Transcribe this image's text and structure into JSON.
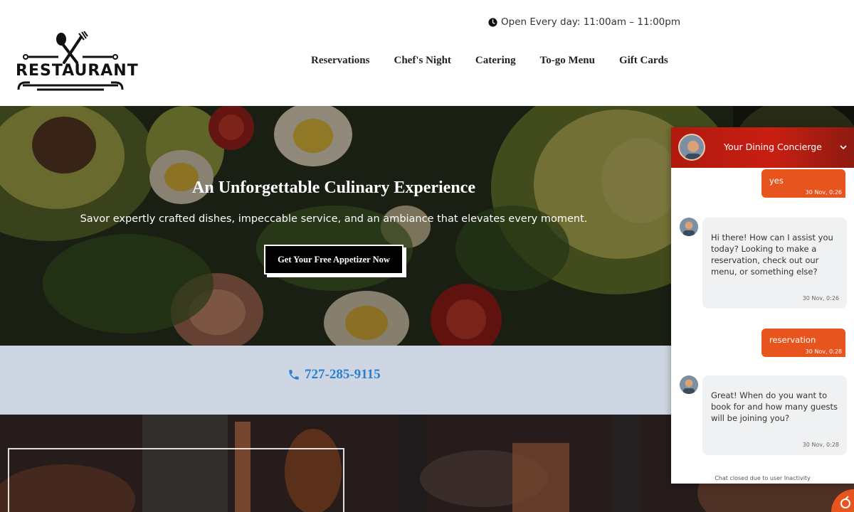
{
  "header": {
    "logo_text": "RESTAURANT",
    "hours": "Open Every day: 11:00am – 11:00pm",
    "nav": [
      "Reservations",
      "Chef's Night",
      "Catering",
      "To-go Menu",
      "Gift Cards"
    ]
  },
  "hero": {
    "title": "An Unforgettable Culinary Experience",
    "subtitle": "Savor expertly crafted dishes, impeccable service, and an ambiance that elevates every moment.",
    "cta": "Get Your Free Appetizer Now"
  },
  "contact": {
    "phone": "727-285-9115"
  },
  "chat": {
    "title": "Your Dining Concierge",
    "messages": [
      {
        "from": "user",
        "text": "yes",
        "time": "30 Nov, 0:26"
      },
      {
        "from": "bot",
        "text": "Hi there! How can I assist you today? Looking to make a reservation, check out our menu, or something else?",
        "time": "30 Nov, 0:26"
      },
      {
        "from": "user",
        "text": "reservation",
        "time": "30 Nov, 0:28"
      },
      {
        "from": "bot",
        "text": "Great! When do you want to book for and how many guests will be joining you?",
        "time": "30 Nov, 0:28"
      }
    ],
    "closed_notice": "Chat closed due to user Inactivity"
  },
  "colors": {
    "accent": "#e8541e",
    "chat_header": "#c81f12",
    "phone_link": "#2a7fd4",
    "band": "#cdd6e2"
  },
  "icons": [
    "clock-icon",
    "phone-icon",
    "chevron-down-icon",
    "chat-launcher-icon"
  ]
}
